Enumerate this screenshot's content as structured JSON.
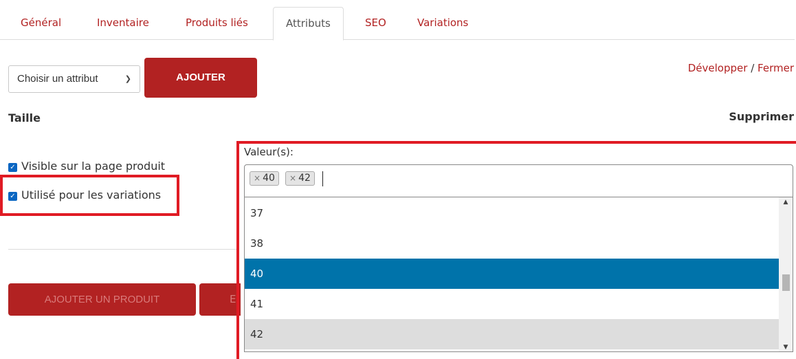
{
  "tabs": [
    {
      "label": "Général",
      "active": false
    },
    {
      "label": "Inventaire",
      "active": false
    },
    {
      "label": "Produits liés",
      "active": false
    },
    {
      "label": "Attributs",
      "active": true
    },
    {
      "label": "SEO",
      "active": false
    },
    {
      "label": "Variations",
      "active": false
    }
  ],
  "attribute_picker": {
    "selected": "Choisir un attribut",
    "add_label": "AJOUTER"
  },
  "links": {
    "expand": "Développer",
    "separator": "/",
    "collapse": "Fermer"
  },
  "attribute": {
    "name": "Taille",
    "remove_label": "Supprimer",
    "visible_label": "Visible sur la page produit",
    "visible_checked": true,
    "variations_label": "Utilisé pour les variations",
    "variations_checked": true
  },
  "values": {
    "label": "Valeur(s):",
    "chips": [
      "40",
      "42"
    ],
    "options": [
      {
        "label": "37",
        "state": "normal"
      },
      {
        "label": "38",
        "state": "normal"
      },
      {
        "label": "40",
        "state": "selected"
      },
      {
        "label": "41",
        "state": "normal"
      },
      {
        "label": "42",
        "state": "hover"
      }
    ]
  },
  "footer": {
    "add_product_label": "AJOUTER UN PRODUIT",
    "second_button_fragment": "E"
  },
  "colors": {
    "accent": "#b22222",
    "selected_option": "#0073aa",
    "highlight_box": "#e01b24"
  }
}
